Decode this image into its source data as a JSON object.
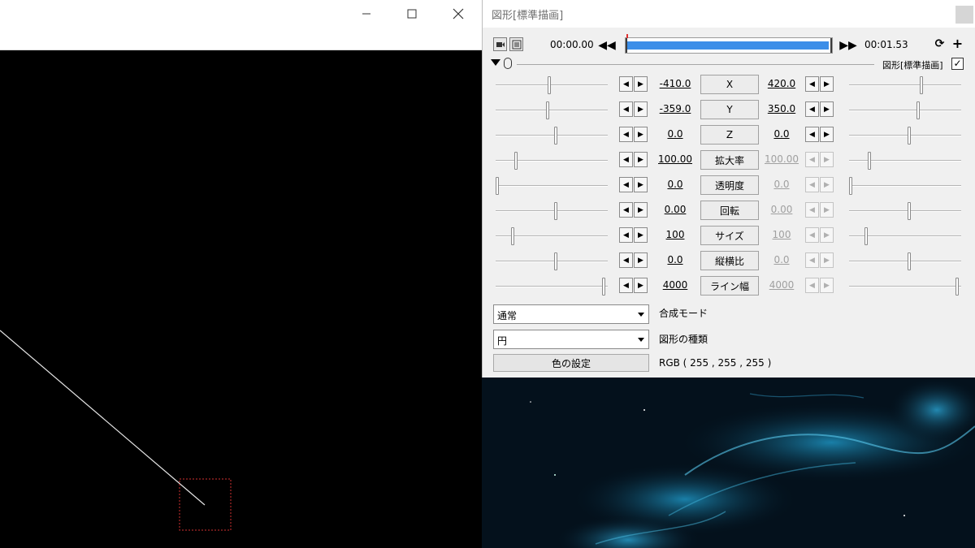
{
  "dialog": {
    "title": "図形[標準描画]",
    "time_start": "00:00.00",
    "time_end": "00:01.53",
    "timeline_progress": 0.99,
    "object_label": "図形[標準描画]",
    "object_checked": "✓"
  },
  "params": [
    {
      "label": "X",
      "left": "-410.0",
      "right": "420.0",
      "right_disabled": false,
      "left_level": 0.48,
      "right_level": 0.65
    },
    {
      "label": "Y",
      "left": "-359.0",
      "right": "350.0",
      "right_disabled": false,
      "left_level": 0.46,
      "right_level": 0.62
    },
    {
      "label": "Z",
      "left": "0.0",
      "right": "0.0",
      "right_disabled": false,
      "left_level": 0.54,
      "right_level": 0.54
    },
    {
      "label": "拡大率",
      "left": "100.00",
      "right": "100.00",
      "right_disabled": true,
      "left_level": 0.17,
      "right_level": 0.17
    },
    {
      "label": "透明度",
      "left": "0.0",
      "right": "0.0",
      "right_disabled": true,
      "left_level": 0.0,
      "right_level": 0.0
    },
    {
      "label": "回転",
      "left": "0.00",
      "right": "0.00",
      "right_disabled": true,
      "left_level": 0.54,
      "right_level": 0.54
    },
    {
      "label": "サイズ",
      "left": "100",
      "right": "100",
      "right_disabled": true,
      "left_level": 0.14,
      "right_level": 0.14
    },
    {
      "label": "縦横比",
      "left": "0.0",
      "right": "0.0",
      "right_disabled": true,
      "left_level": 0.54,
      "right_level": 0.54
    },
    {
      "label": "ライン幅",
      "left": "4000",
      "right": "4000",
      "right_disabled": true,
      "left_level": 0.98,
      "right_level": 0.98
    }
  ],
  "blend_mode": {
    "value": "通常",
    "label": "合成モード"
  },
  "shape_type": {
    "value": "円",
    "label": "図形の種類"
  },
  "color": {
    "button": "色の設定",
    "rgb": "RGB ( 255 , 255 , 255 )"
  }
}
